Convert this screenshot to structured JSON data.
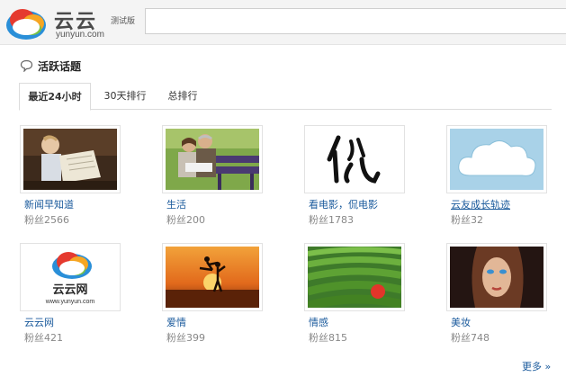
{
  "header": {
    "logo_text": "云云",
    "logo_url": "yunyun.com",
    "beta_label": "测试版",
    "search_value": ""
  },
  "section": {
    "title": "活跃话题"
  },
  "tabs": [
    {
      "label": "最近24小时",
      "active": true
    },
    {
      "label": "30天排行",
      "active": false
    },
    {
      "label": "总排行",
      "active": false
    }
  ],
  "topics": [
    {
      "name": "新闻早知道",
      "fans": "粉丝2566",
      "icon": "boy-reading-newspaper-photo"
    },
    {
      "name": "生活",
      "fans": "粉丝200",
      "icon": "couple-on-bench-photo"
    },
    {
      "name": "看电影，侃电影",
      "fans": "粉丝1783",
      "icon": "calligraphy-kan-photo"
    },
    {
      "name": "云友成长轨迹",
      "fans": "粉丝32",
      "icon": "cloud-illustration"
    },
    {
      "name": "云云网",
      "fans": "粉丝421",
      "icon": "yunyun-logo",
      "logo_text": "云云网",
      "logo_url": "www.yunyun.com"
    },
    {
      "name": "爱情",
      "fans": "粉丝399",
      "icon": "couple-sunset-photo"
    },
    {
      "name": "情感",
      "fans": "粉丝815",
      "icon": "tea-field-photo"
    },
    {
      "name": "美妆",
      "fans": "粉丝748",
      "icon": "makeup-woman-photo"
    }
  ],
  "more_label": "更多 »",
  "colors": {
    "link": "#1a5a9c",
    "muted": "#888888",
    "header_bg": "#f4f4f4"
  }
}
